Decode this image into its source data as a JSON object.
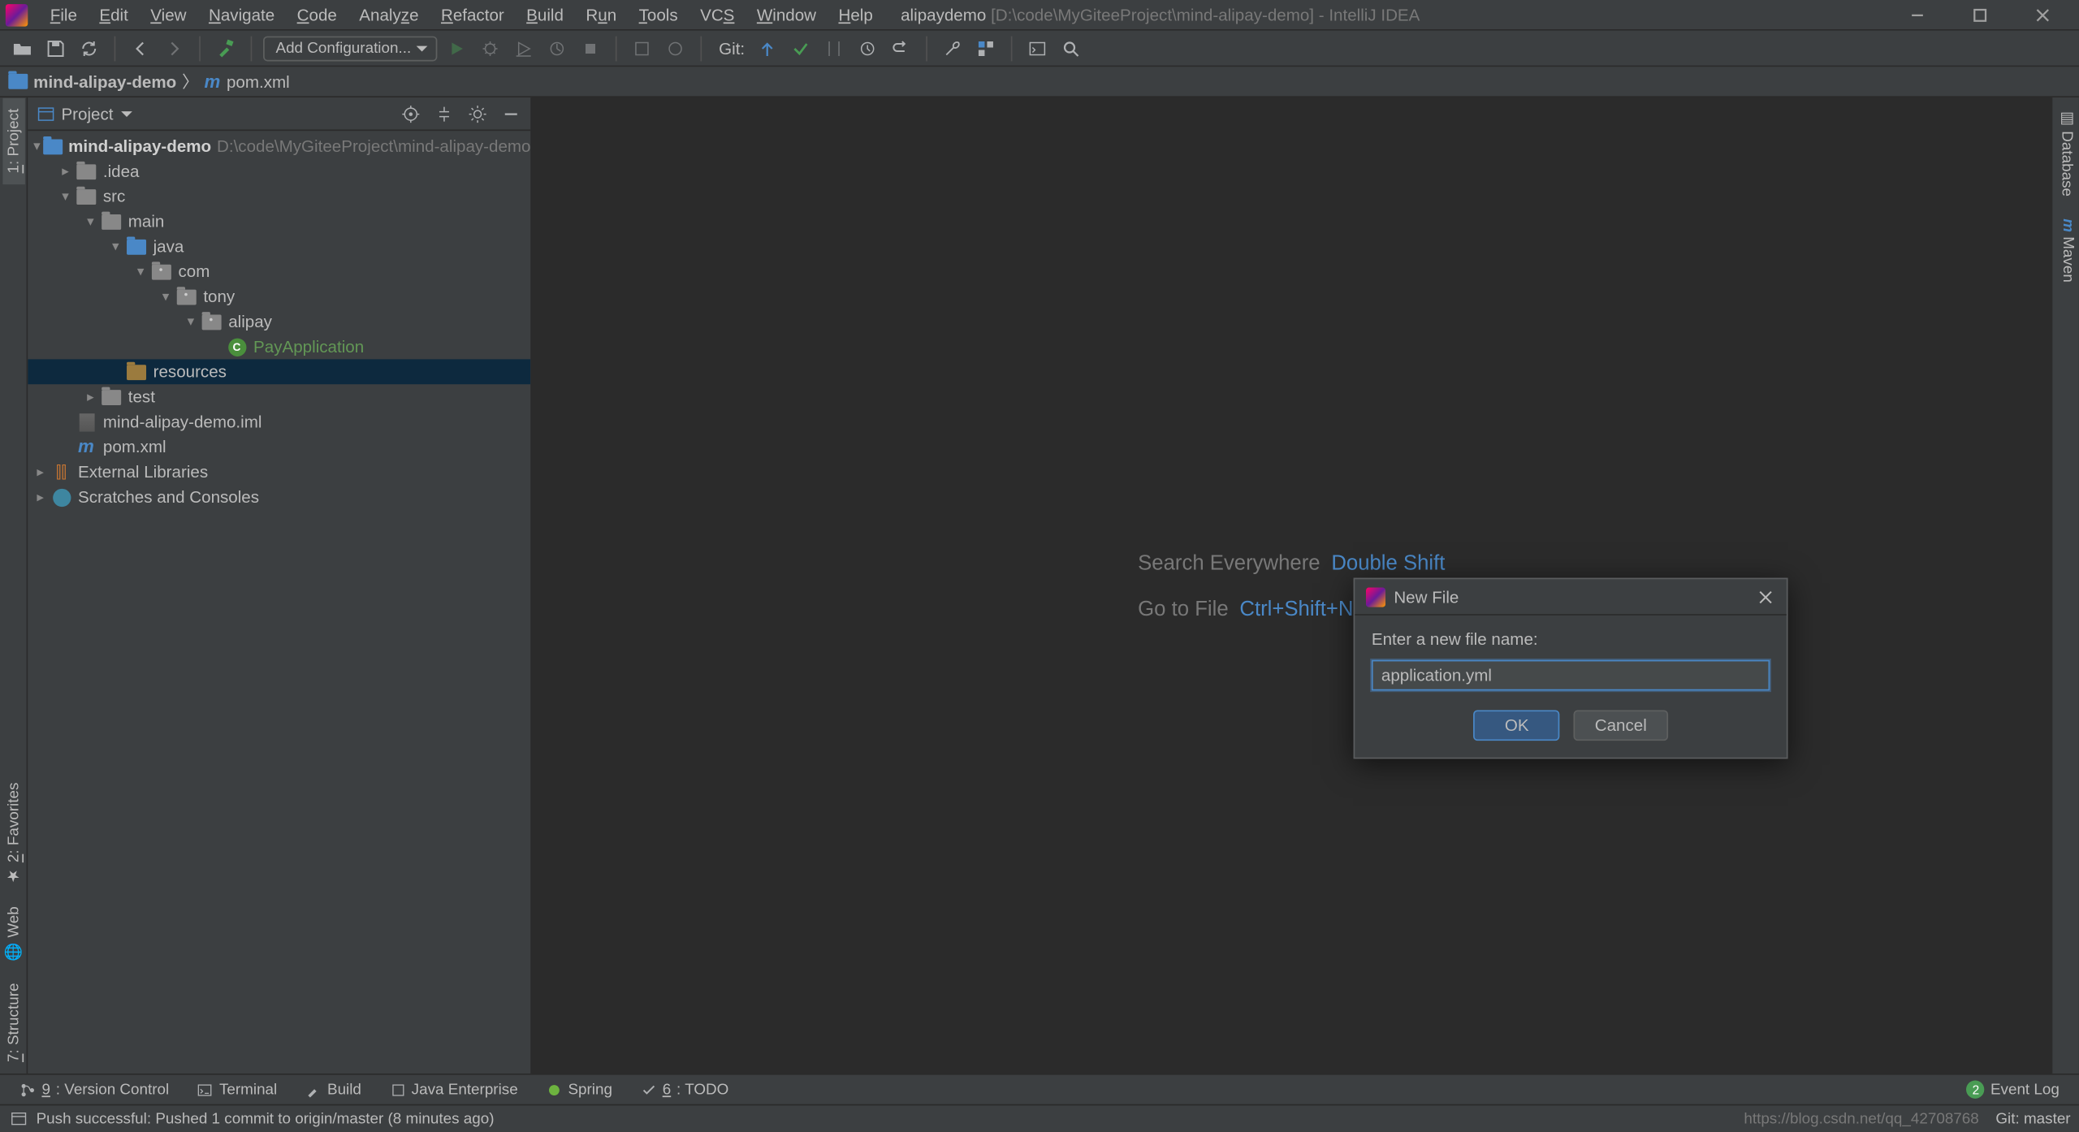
{
  "window": {
    "app_name": "alipaydemo",
    "path": "[D:\\code\\MyGiteeProject\\mind-alipay-demo]",
    "product": "IntelliJ IDEA"
  },
  "menubar": [
    "File",
    "Edit",
    "View",
    "Navigate",
    "Code",
    "Analyze",
    "Refactor",
    "Build",
    "Run",
    "Tools",
    "VCS",
    "Window",
    "Help"
  ],
  "toolbar": {
    "run_config_label": "Add Configuration...",
    "git_label": "Git:"
  },
  "breadcrumb": {
    "root": "mind-alipay-demo",
    "file": "pom.xml"
  },
  "project_tool": {
    "title": "Project"
  },
  "tree": {
    "root_name": "mind-alipay-demo",
    "root_path": "D:\\code\\MyGiteeProject\\mind-alipay-demo",
    "idea": ".idea",
    "src": "src",
    "main": "main",
    "java": "java",
    "pkg_com": "com",
    "pkg_tony": "tony",
    "pkg_alipay": "alipay",
    "class_pay": "PayApplication",
    "resources": "resources",
    "test": "test",
    "iml": "mind-alipay-demo.iml",
    "pom": "pom.xml",
    "ext_lib": "External Libraries",
    "scratches": "Scratches and Consoles"
  },
  "hints": {
    "search_label": "Search Everywhere",
    "search_key": "Double Shift",
    "goto_label": "Go to File",
    "goto_key": "Ctrl+Shift+N"
  },
  "dialog": {
    "title": "New File",
    "prompt": "Enter a new file name:",
    "value": "application.yml",
    "ok": "OK",
    "cancel": "Cancel"
  },
  "left_tabs": {
    "project": "1: Project"
  },
  "right_tabs": {
    "database": "Database",
    "maven": "Maven"
  },
  "left_bottom_tabs": {
    "favorites": "2: Favorites",
    "web": "Web",
    "structure": "7: Structure"
  },
  "bottom_tabs": {
    "vcs": "9: Version Control",
    "terminal": "Terminal",
    "build": "Build",
    "java_ee": "Java Enterprise",
    "spring": "Spring",
    "todo": "6: TODO",
    "event_log": "Event Log",
    "event_badge": "2"
  },
  "status": {
    "message": "Push successful: Pushed 1 commit to origin/master (8 minutes ago)",
    "watermark": "https://blog.csdn.net/qq_42708768",
    "branch": "Git: master"
  }
}
